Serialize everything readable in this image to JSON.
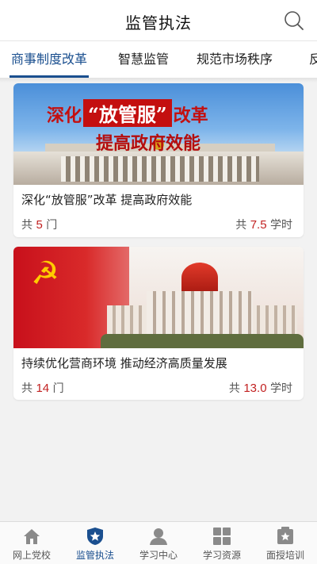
{
  "header": {
    "title": "监管执法",
    "search_icon": "search-icon"
  },
  "tabs": [
    {
      "label": "商事制度改革",
      "active": true
    },
    {
      "label": "智慧监管",
      "active": false
    },
    {
      "label": "规范市场秩序",
      "active": false
    },
    {
      "label": "反",
      "active": false
    }
  ],
  "cards": [
    {
      "banner": {
        "line1_pre": "深化",
        "line1_box": "“放管服”",
        "line1_post": "改革",
        "line2": "提高政府效能"
      },
      "title": "深化“放管服”改革 提高政府效能",
      "count_prefix": "共",
      "count": "5",
      "count_unit": "门",
      "hours_prefix": "共",
      "hours": "7.5",
      "hours_unit": "学时"
    },
    {
      "banner": {
        "flag_glyph": "☭"
      },
      "title": "持续优化营商环境  推动经济高质量发展",
      "count_prefix": "共",
      "count": "14",
      "count_unit": "门",
      "hours_prefix": "共",
      "hours": "13.0",
      "hours_unit": "学时"
    }
  ],
  "tabbar": [
    {
      "label": "网上党校",
      "icon": "home-icon",
      "active": false
    },
    {
      "label": "监管执法",
      "icon": "shield-star-icon",
      "active": true
    },
    {
      "label": "学习中心",
      "icon": "user-icon",
      "active": false
    },
    {
      "label": "学习资源",
      "icon": "grid-icon",
      "active": false
    },
    {
      "label": "面授培训",
      "icon": "board-star-icon",
      "active": false
    }
  ],
  "colors": {
    "accent": "#1a4f8f",
    "number_red": "#c22121",
    "inactive_icon": "#8a8a8a"
  }
}
